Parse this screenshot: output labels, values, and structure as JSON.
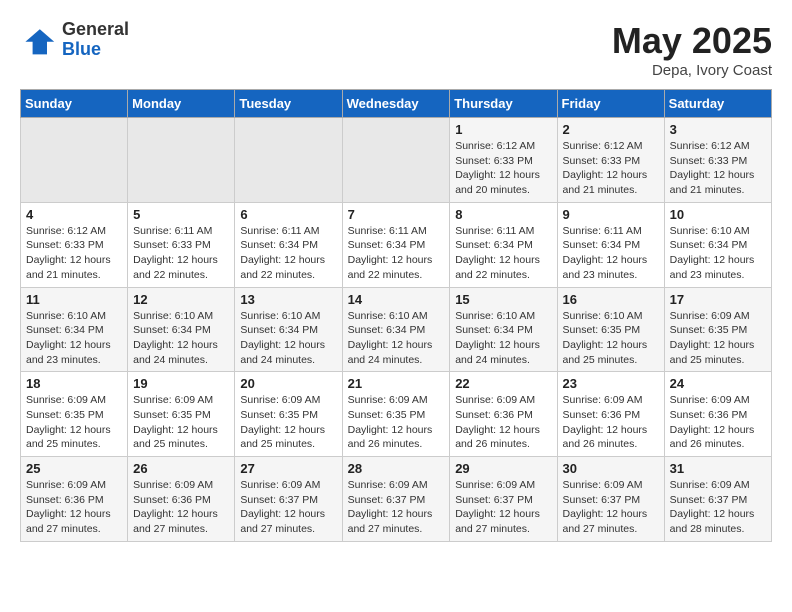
{
  "header": {
    "logo_general": "General",
    "logo_blue": "Blue",
    "month": "May 2025",
    "location": "Depa, Ivory Coast"
  },
  "days_of_week": [
    "Sunday",
    "Monday",
    "Tuesday",
    "Wednesday",
    "Thursday",
    "Friday",
    "Saturday"
  ],
  "weeks": [
    [
      {
        "day": "",
        "info": ""
      },
      {
        "day": "",
        "info": ""
      },
      {
        "day": "",
        "info": ""
      },
      {
        "day": "",
        "info": ""
      },
      {
        "day": "1",
        "info": "Sunrise: 6:12 AM\nSunset: 6:33 PM\nDaylight: 12 hours\nand 20 minutes."
      },
      {
        "day": "2",
        "info": "Sunrise: 6:12 AM\nSunset: 6:33 PM\nDaylight: 12 hours\nand 21 minutes."
      },
      {
        "day": "3",
        "info": "Sunrise: 6:12 AM\nSunset: 6:33 PM\nDaylight: 12 hours\nand 21 minutes."
      }
    ],
    [
      {
        "day": "4",
        "info": "Sunrise: 6:12 AM\nSunset: 6:33 PM\nDaylight: 12 hours\nand 21 minutes."
      },
      {
        "day": "5",
        "info": "Sunrise: 6:11 AM\nSunset: 6:33 PM\nDaylight: 12 hours\nand 22 minutes."
      },
      {
        "day": "6",
        "info": "Sunrise: 6:11 AM\nSunset: 6:34 PM\nDaylight: 12 hours\nand 22 minutes."
      },
      {
        "day": "7",
        "info": "Sunrise: 6:11 AM\nSunset: 6:34 PM\nDaylight: 12 hours\nand 22 minutes."
      },
      {
        "day": "8",
        "info": "Sunrise: 6:11 AM\nSunset: 6:34 PM\nDaylight: 12 hours\nand 22 minutes."
      },
      {
        "day": "9",
        "info": "Sunrise: 6:11 AM\nSunset: 6:34 PM\nDaylight: 12 hours\nand 23 minutes."
      },
      {
        "day": "10",
        "info": "Sunrise: 6:10 AM\nSunset: 6:34 PM\nDaylight: 12 hours\nand 23 minutes."
      }
    ],
    [
      {
        "day": "11",
        "info": "Sunrise: 6:10 AM\nSunset: 6:34 PM\nDaylight: 12 hours\nand 23 minutes."
      },
      {
        "day": "12",
        "info": "Sunrise: 6:10 AM\nSunset: 6:34 PM\nDaylight: 12 hours\nand 24 minutes."
      },
      {
        "day": "13",
        "info": "Sunrise: 6:10 AM\nSunset: 6:34 PM\nDaylight: 12 hours\nand 24 minutes."
      },
      {
        "day": "14",
        "info": "Sunrise: 6:10 AM\nSunset: 6:34 PM\nDaylight: 12 hours\nand 24 minutes."
      },
      {
        "day": "15",
        "info": "Sunrise: 6:10 AM\nSunset: 6:34 PM\nDaylight: 12 hours\nand 24 minutes."
      },
      {
        "day": "16",
        "info": "Sunrise: 6:10 AM\nSunset: 6:35 PM\nDaylight: 12 hours\nand 25 minutes."
      },
      {
        "day": "17",
        "info": "Sunrise: 6:09 AM\nSunset: 6:35 PM\nDaylight: 12 hours\nand 25 minutes."
      }
    ],
    [
      {
        "day": "18",
        "info": "Sunrise: 6:09 AM\nSunset: 6:35 PM\nDaylight: 12 hours\nand 25 minutes."
      },
      {
        "day": "19",
        "info": "Sunrise: 6:09 AM\nSunset: 6:35 PM\nDaylight: 12 hours\nand 25 minutes."
      },
      {
        "day": "20",
        "info": "Sunrise: 6:09 AM\nSunset: 6:35 PM\nDaylight: 12 hours\nand 25 minutes."
      },
      {
        "day": "21",
        "info": "Sunrise: 6:09 AM\nSunset: 6:35 PM\nDaylight: 12 hours\nand 26 minutes."
      },
      {
        "day": "22",
        "info": "Sunrise: 6:09 AM\nSunset: 6:36 PM\nDaylight: 12 hours\nand 26 minutes."
      },
      {
        "day": "23",
        "info": "Sunrise: 6:09 AM\nSunset: 6:36 PM\nDaylight: 12 hours\nand 26 minutes."
      },
      {
        "day": "24",
        "info": "Sunrise: 6:09 AM\nSunset: 6:36 PM\nDaylight: 12 hours\nand 26 minutes."
      }
    ],
    [
      {
        "day": "25",
        "info": "Sunrise: 6:09 AM\nSunset: 6:36 PM\nDaylight: 12 hours\nand 27 minutes."
      },
      {
        "day": "26",
        "info": "Sunrise: 6:09 AM\nSunset: 6:36 PM\nDaylight: 12 hours\nand 27 minutes."
      },
      {
        "day": "27",
        "info": "Sunrise: 6:09 AM\nSunset: 6:37 PM\nDaylight: 12 hours\nand 27 minutes."
      },
      {
        "day": "28",
        "info": "Sunrise: 6:09 AM\nSunset: 6:37 PM\nDaylight: 12 hours\nand 27 minutes."
      },
      {
        "day": "29",
        "info": "Sunrise: 6:09 AM\nSunset: 6:37 PM\nDaylight: 12 hours\nand 27 minutes."
      },
      {
        "day": "30",
        "info": "Sunrise: 6:09 AM\nSunset: 6:37 PM\nDaylight: 12 hours\nand 27 minutes."
      },
      {
        "day": "31",
        "info": "Sunrise: 6:09 AM\nSunset: 6:37 PM\nDaylight: 12 hours\nand 28 minutes."
      }
    ]
  ]
}
